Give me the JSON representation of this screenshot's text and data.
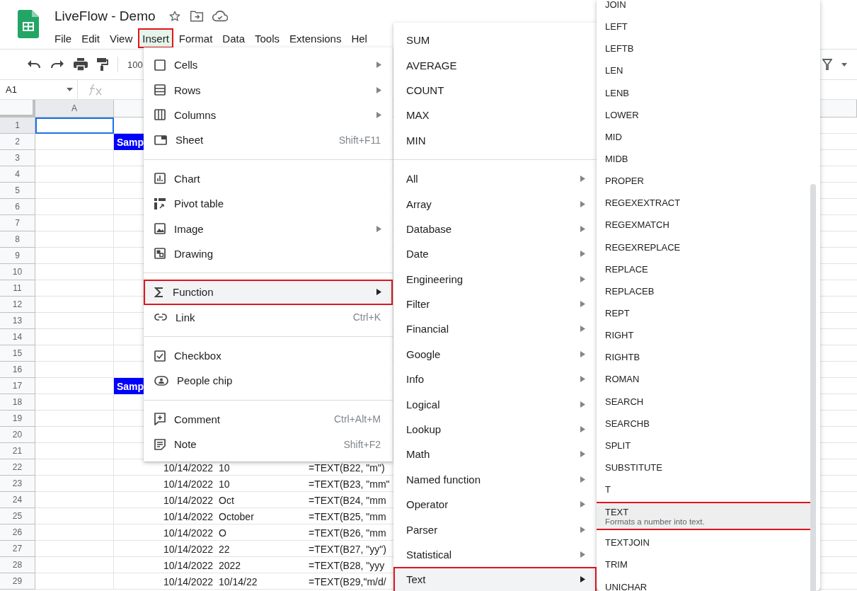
{
  "document": {
    "title": "LiveFlow - Demo"
  },
  "menu_bar": [
    {
      "label": "File",
      "selected": false
    },
    {
      "label": "Edit",
      "selected": false
    },
    {
      "label": "View",
      "selected": false
    },
    {
      "label": "Insert",
      "selected": true
    },
    {
      "label": "Format",
      "selected": false
    },
    {
      "label": "Data",
      "selected": false
    },
    {
      "label": "Tools",
      "selected": false
    },
    {
      "label": "Extensions",
      "selected": false
    },
    {
      "label": "Hel",
      "selected": false
    }
  ],
  "toolbar": {
    "zoom": "100"
  },
  "formula_bar": {
    "cell_reference": "A1"
  },
  "sheet": {
    "columns": [
      "A"
    ],
    "rows": [
      {
        "number": "1",
        "selected": true
      },
      {
        "number": "2",
        "selected": false,
        "banner": "Samp"
      },
      {
        "number": "3",
        "selected": false
      },
      {
        "number": "4",
        "selected": false
      },
      {
        "number": "5",
        "selected": false
      },
      {
        "number": "6",
        "selected": false
      },
      {
        "number": "7",
        "selected": false
      },
      {
        "number": "8",
        "selected": false
      },
      {
        "number": "9",
        "selected": false
      },
      {
        "number": "10",
        "selected": false
      },
      {
        "number": "11",
        "selected": false
      },
      {
        "number": "12",
        "selected": false
      },
      {
        "number": "13",
        "selected": false
      },
      {
        "number": "14",
        "selected": false
      },
      {
        "number": "15",
        "selected": false
      },
      {
        "number": "16",
        "selected": false
      },
      {
        "number": "17",
        "selected": false,
        "banner": "Samp"
      },
      {
        "number": "18",
        "selected": false
      },
      {
        "number": "19",
        "selected": false
      },
      {
        "number": "20",
        "selected": false
      },
      {
        "number": "21",
        "selected": false
      },
      {
        "number": "22",
        "selected": false,
        "date": "10/14/2022",
        "result": "10",
        "formula": "=TEXT(B22, \"m\")"
      },
      {
        "number": "23",
        "selected": false,
        "date": "10/14/2022",
        "result": "10",
        "formula": "=TEXT(B23, \"mm\""
      },
      {
        "number": "24",
        "selected": false,
        "date": "10/14/2022",
        "result": "Oct",
        "formula": "=TEXT(B24, \"mm"
      },
      {
        "number": "25",
        "selected": false,
        "date": "10/14/2022",
        "result": "October",
        "formula": "=TEXT(B25, \"mm"
      },
      {
        "number": "26",
        "selected": false,
        "date": "10/14/2022",
        "result": "O",
        "formula": "=TEXT(B26, \"mm"
      },
      {
        "number": "27",
        "selected": false,
        "date": "10/14/2022",
        "result": "22",
        "formula": "=TEXT(B27, \"yy\")"
      },
      {
        "number": "28",
        "selected": false,
        "date": "10/14/2022",
        "result": "2022",
        "formula": "=TEXT(B28, \"yyy"
      },
      {
        "number": "29",
        "selected": false,
        "date": "10/14/2022",
        "result": "10/14/22",
        "formula": "=TEXT(B29,\"m/d/"
      }
    ]
  },
  "insert_menu": [
    {
      "kind": "item",
      "label": "Cells",
      "has_submenu": true,
      "selected": false
    },
    {
      "kind": "item",
      "label": "Rows",
      "has_submenu": true,
      "selected": false
    },
    {
      "kind": "item",
      "label": "Columns",
      "has_submenu": true,
      "selected": false
    },
    {
      "kind": "item",
      "label": "Sheet",
      "shortcut": "Shift+F11",
      "has_submenu": false,
      "selected": false
    },
    {
      "kind": "separator"
    },
    {
      "kind": "item",
      "label": "Chart",
      "has_submenu": false,
      "selected": false
    },
    {
      "kind": "item",
      "label": "Pivot table",
      "has_submenu": false,
      "selected": false
    },
    {
      "kind": "item",
      "label": "Image",
      "has_submenu": true,
      "selected": false
    },
    {
      "kind": "item",
      "label": "Drawing",
      "has_submenu": false,
      "selected": false
    },
    {
      "kind": "separator"
    },
    {
      "kind": "item",
      "label": "Function",
      "has_submenu": true,
      "selected": true
    },
    {
      "kind": "item",
      "label": "Link",
      "shortcut": "Ctrl+K",
      "has_submenu": false,
      "selected": false
    },
    {
      "kind": "separator"
    },
    {
      "kind": "item",
      "label": "Checkbox",
      "has_submenu": false,
      "selected": false
    },
    {
      "kind": "item",
      "label": "People chip",
      "has_submenu": false,
      "selected": false
    },
    {
      "kind": "separator"
    },
    {
      "kind": "item",
      "label": "Comment",
      "shortcut": "Ctrl+Alt+M",
      "has_submenu": false,
      "selected": false
    },
    {
      "kind": "item",
      "label": "Note",
      "shortcut": "Shift+F2",
      "has_submenu": false,
      "selected": false
    }
  ],
  "function_menu": [
    {
      "kind": "item",
      "label": "SUM",
      "has_submenu": false,
      "selected": false
    },
    {
      "kind": "item",
      "label": "AVERAGE",
      "has_submenu": false,
      "selected": false
    },
    {
      "kind": "item",
      "label": "COUNT",
      "has_submenu": false,
      "selected": false
    },
    {
      "kind": "item",
      "label": "MAX",
      "has_submenu": false,
      "selected": false
    },
    {
      "kind": "item",
      "label": "MIN",
      "has_submenu": false,
      "selected": false
    },
    {
      "kind": "separator"
    },
    {
      "kind": "item",
      "label": "All",
      "has_submenu": true,
      "selected": false
    },
    {
      "kind": "item",
      "label": "Array",
      "has_submenu": true,
      "selected": false
    },
    {
      "kind": "item",
      "label": "Database",
      "has_submenu": true,
      "selected": false
    },
    {
      "kind": "item",
      "label": "Date",
      "has_submenu": true,
      "selected": false
    },
    {
      "kind": "item",
      "label": "Engineering",
      "has_submenu": true,
      "selected": false
    },
    {
      "kind": "item",
      "label": "Filter",
      "has_submenu": true,
      "selected": false
    },
    {
      "kind": "item",
      "label": "Financial",
      "has_submenu": true,
      "selected": false
    },
    {
      "kind": "item",
      "label": "Google",
      "has_submenu": true,
      "selected": false
    },
    {
      "kind": "item",
      "label": "Info",
      "has_submenu": true,
      "selected": false
    },
    {
      "kind": "item",
      "label": "Logical",
      "has_submenu": true,
      "selected": false
    },
    {
      "kind": "item",
      "label": "Lookup",
      "has_submenu": true,
      "selected": false
    },
    {
      "kind": "item",
      "label": "Math",
      "has_submenu": true,
      "selected": false
    },
    {
      "kind": "item",
      "label": "Named function",
      "has_submenu": true,
      "selected": false
    },
    {
      "kind": "item",
      "label": "Operator",
      "has_submenu": true,
      "selected": false
    },
    {
      "kind": "item",
      "label": "Parser",
      "has_submenu": true,
      "selected": false
    },
    {
      "kind": "item",
      "label": "Statistical",
      "has_submenu": true,
      "selected": false
    },
    {
      "kind": "item",
      "label": "Text",
      "has_submenu": true,
      "selected": true
    }
  ],
  "text_menu": [
    {
      "label": "JOIN",
      "selected": false
    },
    {
      "label": "LEFT",
      "selected": false
    },
    {
      "label": "LEFTB",
      "selected": false
    },
    {
      "label": "LEN",
      "selected": false
    },
    {
      "label": "LENB",
      "selected": false
    },
    {
      "label": "LOWER",
      "selected": false
    },
    {
      "label": "MID",
      "selected": false
    },
    {
      "label": "MIDB",
      "selected": false
    },
    {
      "label": "PROPER",
      "selected": false
    },
    {
      "label": "REGEXEXTRACT",
      "selected": false
    },
    {
      "label": "REGEXMATCH",
      "selected": false
    },
    {
      "label": "REGEXREPLACE",
      "selected": false
    },
    {
      "label": "REPLACE",
      "selected": false
    },
    {
      "label": "REPLACEB",
      "selected": false
    },
    {
      "label": "REPT",
      "selected": false
    },
    {
      "label": "RIGHT",
      "selected": false
    },
    {
      "label": "RIGHTB",
      "selected": false
    },
    {
      "label": "ROMAN",
      "selected": false
    },
    {
      "label": "SEARCH",
      "selected": false
    },
    {
      "label": "SEARCHB",
      "selected": false
    },
    {
      "label": "SPLIT",
      "selected": false
    },
    {
      "label": "SUBSTITUTE",
      "selected": false
    },
    {
      "label": "T",
      "selected": false
    },
    {
      "label": "TEXT",
      "description": "Formats a number into text.",
      "selected": true
    },
    {
      "label": "TEXTJOIN",
      "selected": false
    },
    {
      "label": "TRIM",
      "selected": false
    },
    {
      "label": "UNICHAR",
      "selected": false
    }
  ]
}
